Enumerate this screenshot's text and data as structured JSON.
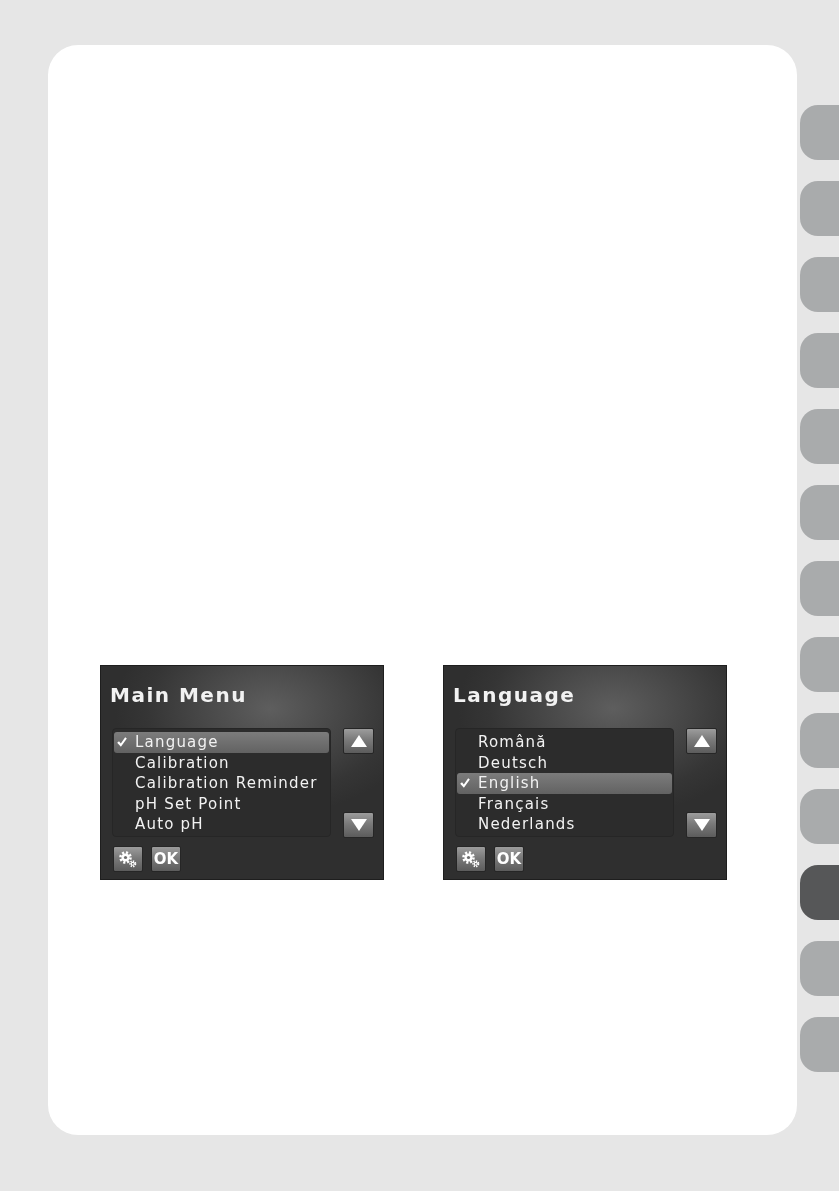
{
  "screens": [
    {
      "title": "Main Menu",
      "items": [
        {
          "label": "Language",
          "selected": true
        },
        {
          "label": "Calibration",
          "selected": false
        },
        {
          "label": "Calibration Reminder",
          "selected": false
        },
        {
          "label": "pH Set Point",
          "selected": false
        },
        {
          "label": "Auto pH",
          "selected": false
        }
      ],
      "ok_button": "OK"
    },
    {
      "title": "Language",
      "items": [
        {
          "label": "Română",
          "selected": false
        },
        {
          "label": "Deutsch",
          "selected": false
        },
        {
          "label": "English",
          "selected": true
        },
        {
          "label": "Français",
          "selected": false
        },
        {
          "label": "Nederlands",
          "selected": false
        }
      ],
      "ok_button": "OK"
    }
  ],
  "side_tabs": [
    {
      "selected": false
    },
    {
      "selected": false
    },
    {
      "selected": false
    },
    {
      "selected": false
    },
    {
      "selected": false
    },
    {
      "selected": false
    },
    {
      "selected": false
    },
    {
      "selected": false
    },
    {
      "selected": false
    },
    {
      "selected": false
    },
    {
      "selected": true
    },
    {
      "selected": false
    },
    {
      "selected": false
    }
  ]
}
